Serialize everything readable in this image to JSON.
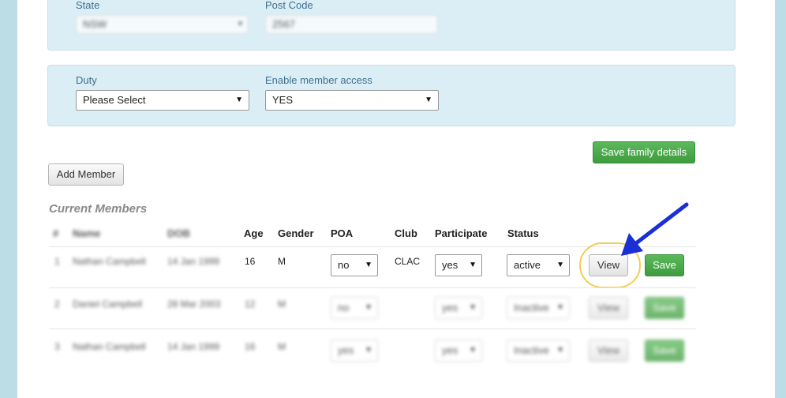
{
  "address": {
    "state_label": "State",
    "state_value": "NSW",
    "postcode_label": "Post Code",
    "postcode_value": "2567"
  },
  "access": {
    "duty_label": "Duty",
    "duty_value": "Please Select",
    "member_access_label": "Enable member access",
    "member_access_value": "YES"
  },
  "buttons": {
    "save_family": "Save family details",
    "add_member": "Add Member"
  },
  "members": {
    "title": "Current Members",
    "headers": [
      "#",
      "Name",
      "DOB",
      "Age",
      "Gender",
      "POA",
      "Club",
      "Participate",
      "Status"
    ],
    "rows": [
      {
        "num": "1",
        "name": "Nathan Campbell",
        "dob": "14 Jan 1999",
        "age": "16",
        "gender": "M",
        "poa": "no",
        "club": "CLAC",
        "participate": "yes",
        "status": "active",
        "view": "View",
        "save": "Save"
      },
      {
        "num": "2",
        "name": "Daniel Campbell",
        "dob": "28 Mar 2003",
        "age": "12",
        "gender": "M",
        "poa": "no",
        "club": "",
        "participate": "yes",
        "status": "Inactive",
        "view": "View",
        "save": "Save"
      },
      {
        "num": "3",
        "name": "Nathan Campbell",
        "dob": "14 Jan 1999",
        "age": "16",
        "gender": "M",
        "poa": "yes",
        "club": "",
        "participate": "yes",
        "status": "Inactive",
        "view": "View",
        "save": "Save"
      }
    ]
  },
  "colors": {
    "accent_green": "#4cae4c",
    "panel_bg": "#dbeef6",
    "arrow": "#1a2fd6",
    "highlight": "#f2cd55"
  }
}
